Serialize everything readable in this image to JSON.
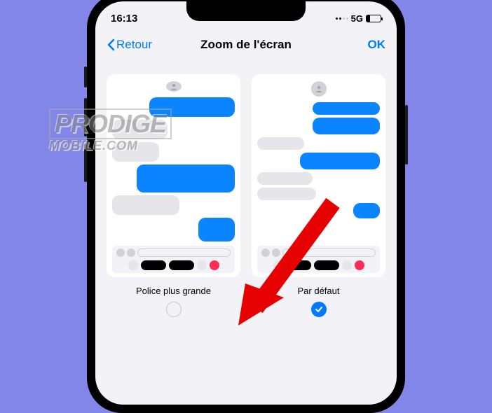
{
  "status": {
    "time": "16:13",
    "network": "5G"
  },
  "nav": {
    "back": "Retour",
    "title": "Zoom de l'écran",
    "ok": "OK"
  },
  "options": {
    "large": {
      "label": "Police plus grande",
      "selected": false
    },
    "default": {
      "label": "Par défaut",
      "selected": true
    }
  },
  "watermark": {
    "line1": "PRODIGE",
    "line2": "MOBILE.COM"
  }
}
